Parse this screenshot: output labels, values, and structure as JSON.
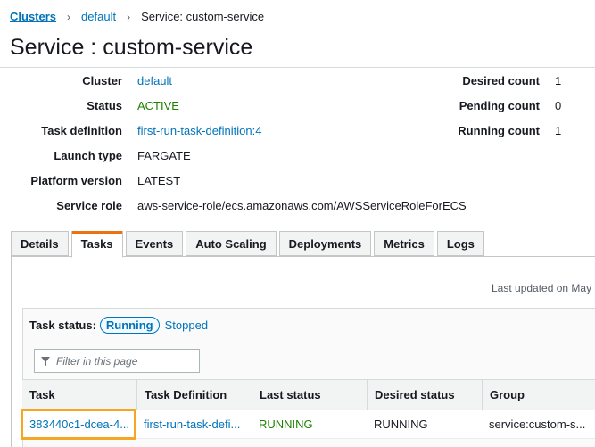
{
  "breadcrumb": {
    "items": [
      "Clusters",
      "default"
    ],
    "current": "Service: custom-service"
  },
  "title": "Service : custom-service",
  "summary_left": [
    {
      "label": "Cluster",
      "value": "default"
    },
    {
      "label": "Status",
      "value": "ACTIVE"
    },
    {
      "label": "Task definition",
      "value": "first-run-task-definition:4"
    },
    {
      "label": "Launch type",
      "value": "FARGATE"
    },
    {
      "label": "Platform version",
      "value": "LATEST"
    },
    {
      "label": "Service role",
      "value": "aws-service-role/ecs.amazonaws.com/AWSServiceRoleForECS"
    }
  ],
  "summary_right": [
    {
      "label": "Desired count",
      "value": "1"
    },
    {
      "label": "Pending count",
      "value": "0"
    },
    {
      "label": "Running count",
      "value": "1"
    }
  ],
  "tabs": [
    "Details",
    "Tasks",
    "Events",
    "Auto Scaling",
    "Deployments",
    "Metrics",
    "Logs"
  ],
  "active_tab": "Tasks",
  "last_updated": "Last updated on May",
  "task_status": {
    "label": "Task status:",
    "running": "Running",
    "stopped": "Stopped"
  },
  "filter": {
    "placeholder": "Filter in this page",
    "icon": "filter-icon"
  },
  "table": {
    "headers": [
      "Task",
      "Task Definition",
      "Last status",
      "Desired status",
      "Group"
    ],
    "rows": [
      [
        "383440c1-dcea-4...",
        "first-run-task-defi...",
        "RUNNING",
        "RUNNING",
        "service:custom-s..."
      ]
    ]
  },
  "colors": {
    "link": "#0073bb",
    "active_green": "#1d8102",
    "tab_accent": "#ec7211",
    "highlight": "#f5a623"
  }
}
